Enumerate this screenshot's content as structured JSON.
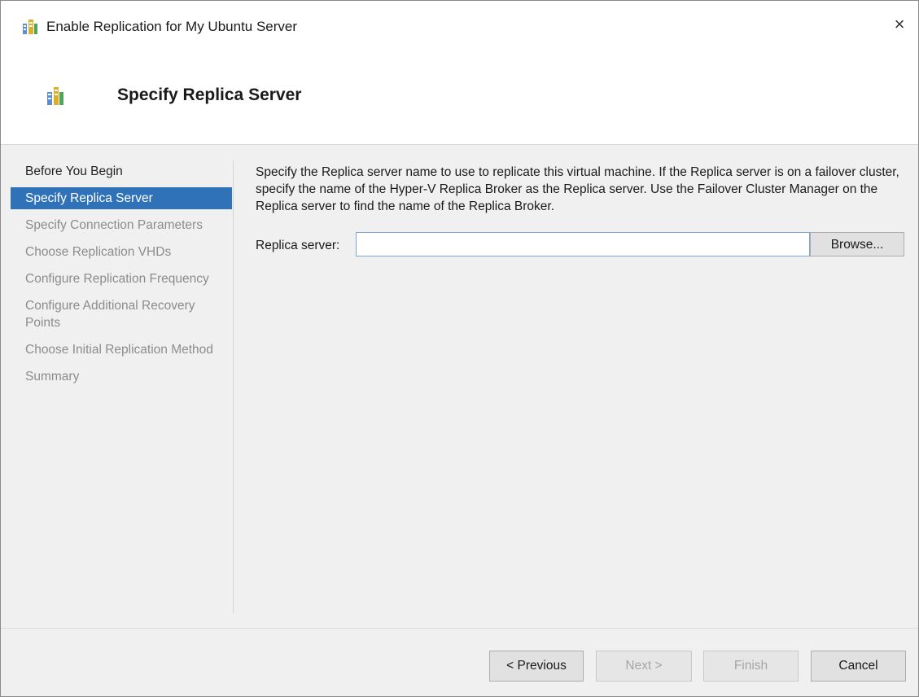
{
  "window": {
    "title": "Enable Replication for My Ubuntu Server",
    "close_glyph": "×"
  },
  "header": {
    "title": "Specify Replica Server",
    "icon": "replication-server-icon"
  },
  "nav": {
    "items": [
      {
        "label": "Before You Begin",
        "state": "done"
      },
      {
        "label": "Specify Replica Server",
        "state": "selected"
      },
      {
        "label": "Specify Connection Parameters",
        "state": "pending"
      },
      {
        "label": "Choose Replication VHDs",
        "state": "pending"
      },
      {
        "label": "Configure Replication Frequency",
        "state": "pending"
      },
      {
        "label": "Configure Additional Recovery Points",
        "state": "pending"
      },
      {
        "label": "Choose Initial Replication Method",
        "state": "pending"
      },
      {
        "label": "Summary",
        "state": "pending"
      }
    ]
  },
  "main": {
    "description": "Specify the Replica server name to use to replicate this virtual machine. If the Replica server is on a failover cluster, specify the name of the Hyper-V Replica Broker as the Replica server. Use the Failover Cluster Manager on the Replica server to find the name of the Replica Broker.",
    "replica_label": "Replica server:",
    "replica_value": "",
    "browse_label": "Browse..."
  },
  "footer": {
    "previous_label": "< Previous",
    "next_label": "Next >",
    "finish_label": "Finish",
    "cancel_label": "Cancel"
  },
  "colors": {
    "selected_nav": "#2f72b8",
    "input_border": "#7aa7d6"
  }
}
